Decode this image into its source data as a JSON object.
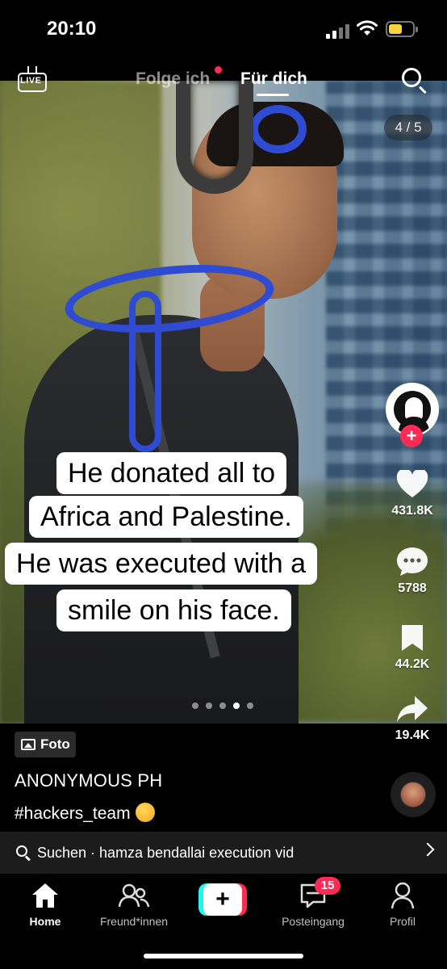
{
  "status_bar": {
    "time": "20:10"
  },
  "top_nav": {
    "live_label": "LIVE",
    "tab_following": "Folge ich",
    "tab_for_you": "Für dich"
  },
  "photo": {
    "counter": "4 / 5",
    "caption_lines": [
      "He donated all to",
      "Africa and Palestine.",
      "He was executed with a",
      "smile on his face."
    ],
    "dots_total": 5,
    "dots_active_index": 3
  },
  "actions": {
    "likes": "431.8K",
    "comments": "5788",
    "saves": "44.2K",
    "shares": "19.4K"
  },
  "post": {
    "type_label": "Foto",
    "author": "ANONYMOUS PH",
    "hashtag": "#hackers_team"
  },
  "search_bar": {
    "text": "Suchen · hamza bendallai execution vid"
  },
  "tab_bar": {
    "home": "Home",
    "friends": "Freund*innen",
    "create": "+",
    "inbox": "Posteingang",
    "inbox_badge": "15",
    "profile": "Profil"
  },
  "colors": {
    "accent_red": "#fe2c55",
    "accent_cyan": "#25f4ee"
  }
}
